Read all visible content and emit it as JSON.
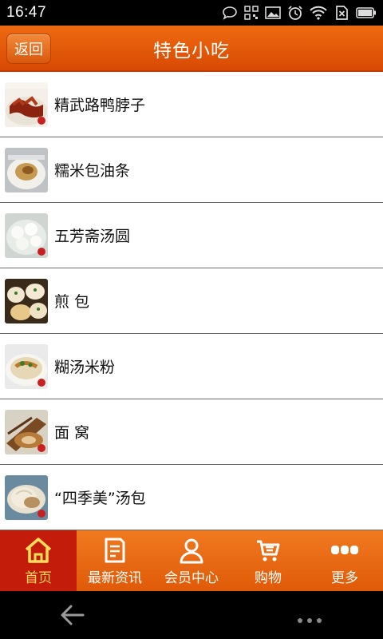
{
  "status_bar": {
    "time": "16:47",
    "icons": [
      "chat-icon",
      "qr-icon",
      "image-icon",
      "alarm-icon",
      "wifi-icon",
      "no-sim-icon",
      "battery-icon"
    ]
  },
  "header": {
    "back_label": "返回",
    "title": "特色小吃"
  },
  "items": [
    {
      "title": "精武路鸭脖子",
      "thumb": "duck-neck-photo"
    },
    {
      "title": "糯米包油条",
      "thumb": "sticky-rice-photo"
    },
    {
      "title": "五芳斋汤圆",
      "thumb": "tangyuan-photo"
    },
    {
      "title": "煎 包",
      "thumb": "fried-bun-photo"
    },
    {
      "title": "糊汤米粉",
      "thumb": "rice-noodle-photo"
    },
    {
      "title": "面 窝",
      "thumb": "mianwo-photo"
    },
    {
      "title": "“四季美”汤包",
      "thumb": "soup-dumpling-photo"
    }
  ],
  "tabs": [
    {
      "label": "首页",
      "icon": "home-icon",
      "active": true
    },
    {
      "label": "最新资讯",
      "icon": "news-icon",
      "active": false
    },
    {
      "label": "会员中心",
      "icon": "user-icon",
      "active": false
    },
    {
      "label": "购物",
      "icon": "cart-icon",
      "active": false
    },
    {
      "label": "更多",
      "icon": "more-icon",
      "active": false
    }
  ],
  "colors": {
    "header": "#e25a08",
    "tab_active_bg": "#c31c0a",
    "tab_active_text": "#ffde5a"
  }
}
